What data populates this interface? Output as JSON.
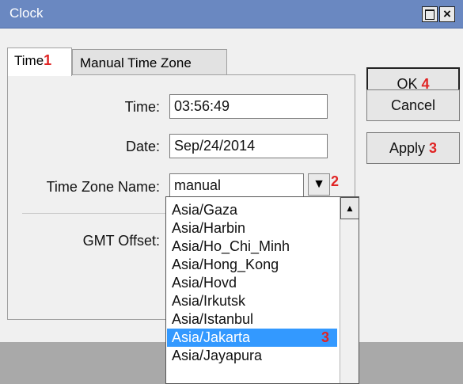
{
  "window": {
    "title": "Clock"
  },
  "tabs": [
    {
      "label": "Time",
      "marker": "1"
    },
    {
      "label": "Manual Time Zone"
    }
  ],
  "form": {
    "time_label": "Time:",
    "time_value": "03:56:49",
    "date_label": "Date:",
    "date_value": "Sep/24/2014",
    "tz_label": "Time Zone Name:",
    "tz_value": "manual",
    "tz_marker": "2",
    "gmt_label": "GMT Offset:"
  },
  "buttons": {
    "ok": "OK",
    "ok_marker": "4",
    "cancel": "Cancel",
    "apply": "Apply",
    "apply_marker": "3"
  },
  "dropdown": {
    "options": [
      "Asia/Gaza",
      "Asia/Harbin",
      "Asia/Ho_Chi_Minh",
      "Asia/Hong_Kong",
      "Asia/Hovd",
      "Asia/Irkutsk",
      "Asia/Istanbul",
      "Asia/Jakarta",
      "Asia/Jayapura"
    ],
    "selected_index": 7,
    "selected_marker": "3"
  }
}
